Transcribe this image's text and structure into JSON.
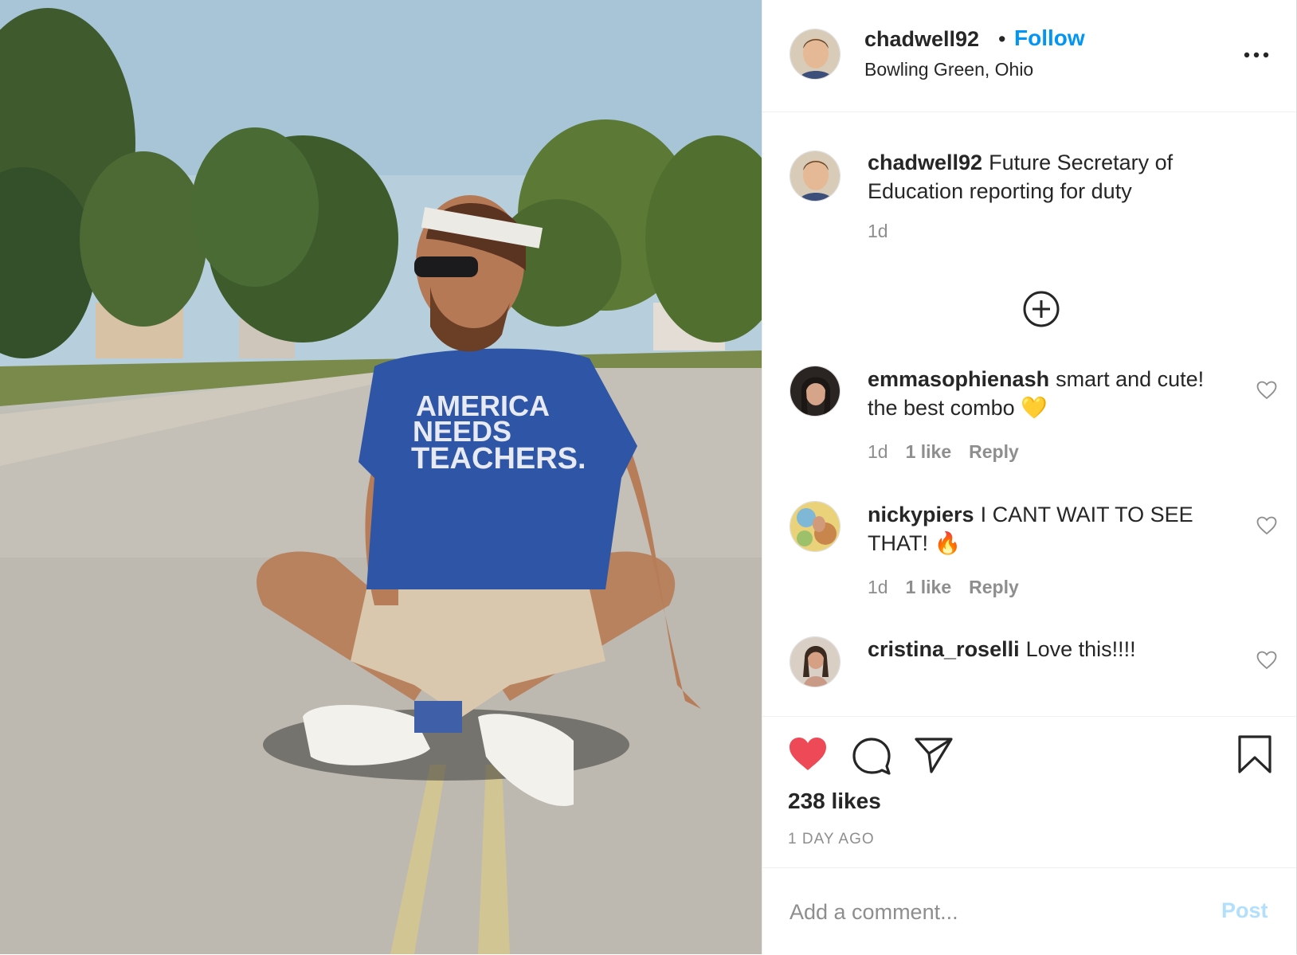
{
  "colors": {
    "accent": "#0095f6",
    "text": "#262626",
    "muted": "#8e8e8e",
    "like_red": "#ed4956",
    "post_disabled": "#b2dffc"
  },
  "post": {
    "image_alt": "Photo of a man sitting cross-legged in the middle of a road wearing a blue t-shirt",
    "shirt_text": [
      "AMERICA",
      "NEEDS",
      "TEACHERS."
    ]
  },
  "header": {
    "username": "chadwell92",
    "separator": "•",
    "follow_label": "Follow",
    "location": "Bowling Green, Ohio",
    "more_icon": "more-options-icon"
  },
  "caption": {
    "username": "chadwell92",
    "text": "Future Secretary of Education reporting for duty",
    "time": "1d"
  },
  "load_more_icon": "plus-circle-icon",
  "comments": [
    {
      "username": "emmasophienash",
      "text": "smart and cute! the best combo 💛",
      "time": "1d",
      "likes": "1 like",
      "reply": "Reply"
    },
    {
      "username": "nickypiers",
      "text": "I CANT WAIT TO SEE THAT! 🔥",
      "time": "1d",
      "likes": "1 like",
      "reply": "Reply"
    },
    {
      "username": "cristina_roselli",
      "text": "Love this!!!!"
    }
  ],
  "actions": {
    "like_icon": "heart-filled-icon",
    "comment_icon": "comment-icon",
    "share_icon": "share-icon",
    "save_icon": "bookmark-icon",
    "likes_count": "238 likes",
    "time_ago": "1 DAY AGO"
  },
  "comment_box": {
    "placeholder": "Add a comment...",
    "post_label": "Post"
  }
}
